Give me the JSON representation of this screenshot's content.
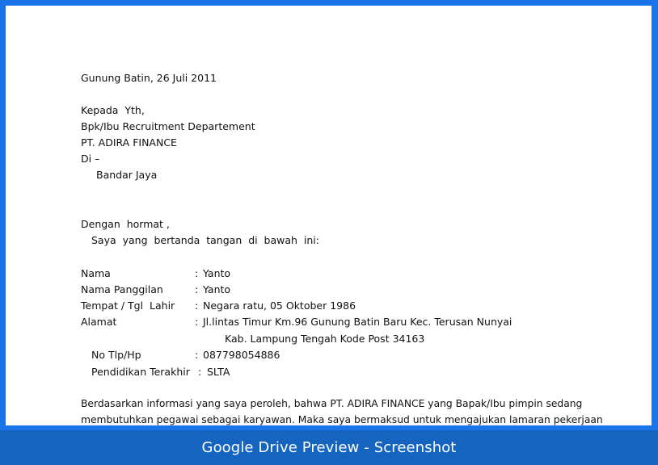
{
  "letter": {
    "place_date": "Gunung Batin, 26 Juli 2011",
    "to_line1": "Kepada  Yth,",
    "to_line2": "Bpk/Ibu Recruitment Departement",
    "to_line3": "PT. ADIRA FINANCE",
    "to_line4": "Di –",
    "to_line5": "Bandar Jaya",
    "greeting": "Dengan  hormat ,",
    "intro": "Saya  yang  bertanda  tangan  di  bawah  ini:",
    "fields": [
      {
        "label": "Nama",
        "colon": ":",
        "value": "Yanto"
      },
      {
        "label": "Nama Panggilan",
        "colon": ":",
        "value": "Yanto"
      },
      {
        "label": "Tempat / Tgl  Lahir",
        "colon": ":",
        "value": "Negara ratu, 05 Oktober 1986"
      },
      {
        "label": "Alamat",
        "colon": ":",
        "value": "Jl.lintas Timur Km.96 Gunung Batin Baru Kec. Terusan Nunyai"
      },
      {
        "label": "No Tlp/Hp",
        "colon": ":",
        "value": "087798054886"
      },
      {
        "label": "Pendidikan Terakhir",
        "colon": ":",
        "value": "SLTA"
      }
    ],
    "address_cont": "Kab. Lampung Tengah Kode Post 34163",
    "body_line1": "Berdasarkan informasi yang saya peroleh, bahwa PT. ADIRA FINANCE yang Bapak/Ibu pimpin sedang",
    "body_line2": "membutuhkan pegawai sebagai karyawan. Maka saya bermaksud untuk mengajukan lamaran pekerjaan"
  },
  "footer": {
    "title": "Google Drive Preview - Screenshot"
  }
}
